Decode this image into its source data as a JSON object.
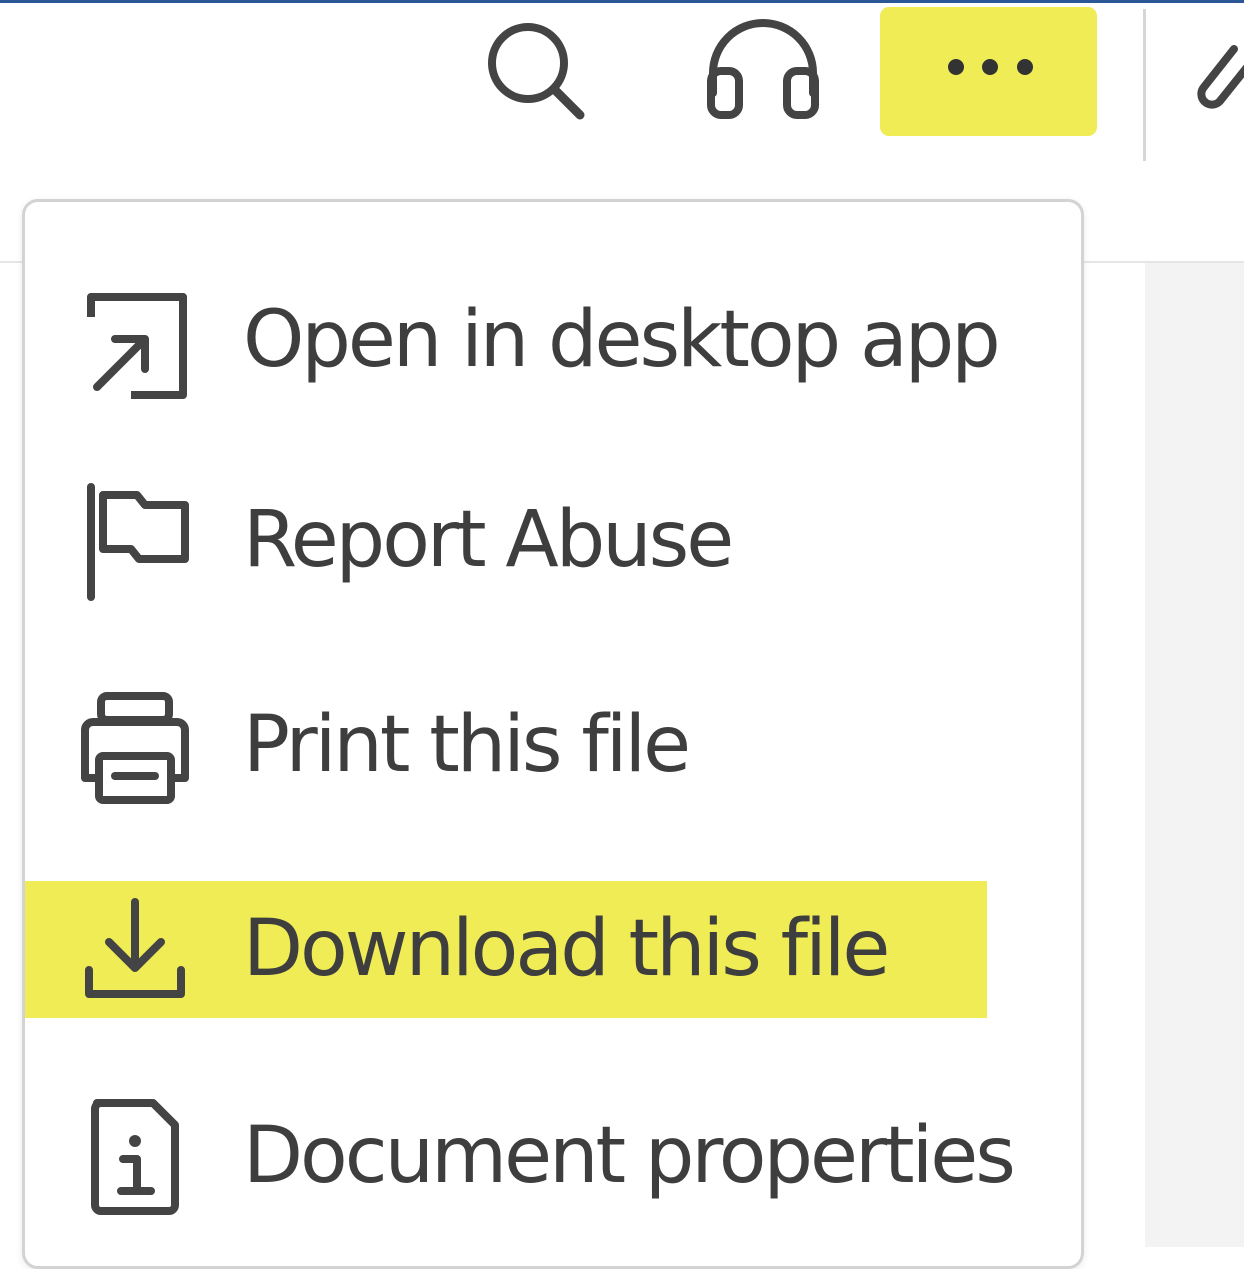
{
  "colors": {
    "highlight": "#efec55",
    "icon_stroke": "#444444",
    "text": "#3e3e3e",
    "top_accent": "#2b5797"
  },
  "toolbar": {
    "buttons": [
      {
        "name": "search",
        "icon": "search-icon"
      },
      {
        "name": "listen",
        "icon": "headphones-icon"
      },
      {
        "name": "more",
        "icon": "more-horizontal-icon",
        "highlighted": true
      },
      {
        "name": "edit",
        "icon": "pencil-icon"
      }
    ]
  },
  "menu": {
    "items": [
      {
        "label": "Open in desktop app",
        "icon": "open-external-icon"
      },
      {
        "label": "Report Abuse",
        "icon": "flag-icon"
      },
      {
        "label": "Print this file",
        "icon": "printer-icon"
      },
      {
        "label": "Download this file",
        "icon": "download-icon",
        "highlighted": true
      },
      {
        "label": "Document properties",
        "icon": "info-document-icon"
      }
    ]
  }
}
